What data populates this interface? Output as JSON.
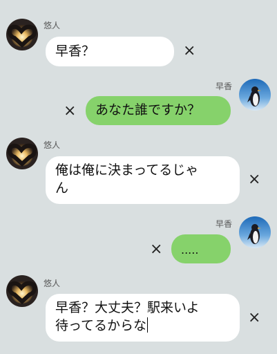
{
  "messages": [
    {
      "side": "left",
      "sender": "悠人",
      "text": "早香？",
      "mark": "×"
    },
    {
      "side": "right",
      "sender": "早香",
      "text": "あなた誰ですか？",
      "mark": "×"
    },
    {
      "side": "left",
      "sender": "悠人",
      "lines": [
        "俺は俺に決まってるじゃ",
        "ん"
      ],
      "mark": "×"
    },
    {
      "side": "right",
      "sender": "早香",
      "text": ".....",
      "mark": "×"
    },
    {
      "side": "left",
      "sender": "悠人",
      "lines": [
        "早香？大丈夫？駅来いよ",
        "待ってるからな"
      ],
      "mark": "×"
    }
  ]
}
